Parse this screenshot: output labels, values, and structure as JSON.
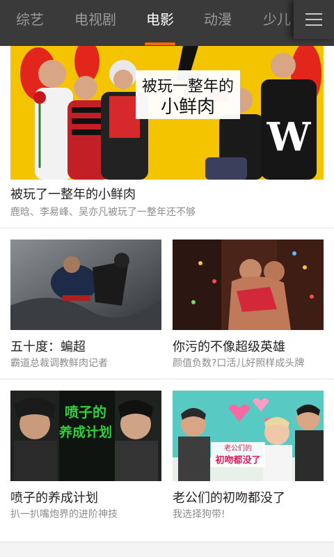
{
  "tabs": [
    {
      "label": "综艺",
      "active": false
    },
    {
      "label": "电视剧",
      "active": false
    },
    {
      "label": "电影",
      "active": true
    },
    {
      "label": "动漫",
      "active": false
    },
    {
      "label": "少儿",
      "active": false
    }
  ],
  "accent_color": "#ff6a00",
  "menu_icon": "hamburger-menu-icon",
  "feature": {
    "image_text_line1": "被玩一整年的",
    "image_text_line2": "小鲜肉",
    "image_badge": "W",
    "title": "被玩了一整年的小鲜肉",
    "subtitle": "鹿晗、李易峰、吴亦凡被玩了一整年还不够"
  },
  "cards": [
    {
      "title": "五十度：蝙超",
      "subtitle": "霸道总裁调教鲜肉记者"
    },
    {
      "title": "你污的不像超级英雄",
      "subtitle": "颜值负数?口活儿好照样成头牌"
    },
    {
      "title": "喷子的养成计划",
      "subtitle": "扒一扒嘴炮界的进阶神技",
      "image_text_line1": "喷子的",
      "image_text_line2": "养成计划"
    },
    {
      "title": "老公们的初吻都没了",
      "subtitle": "我选择狗带!",
      "image_text_line1": "老公们的",
      "image_text_line2": "初吻都没了"
    }
  ]
}
